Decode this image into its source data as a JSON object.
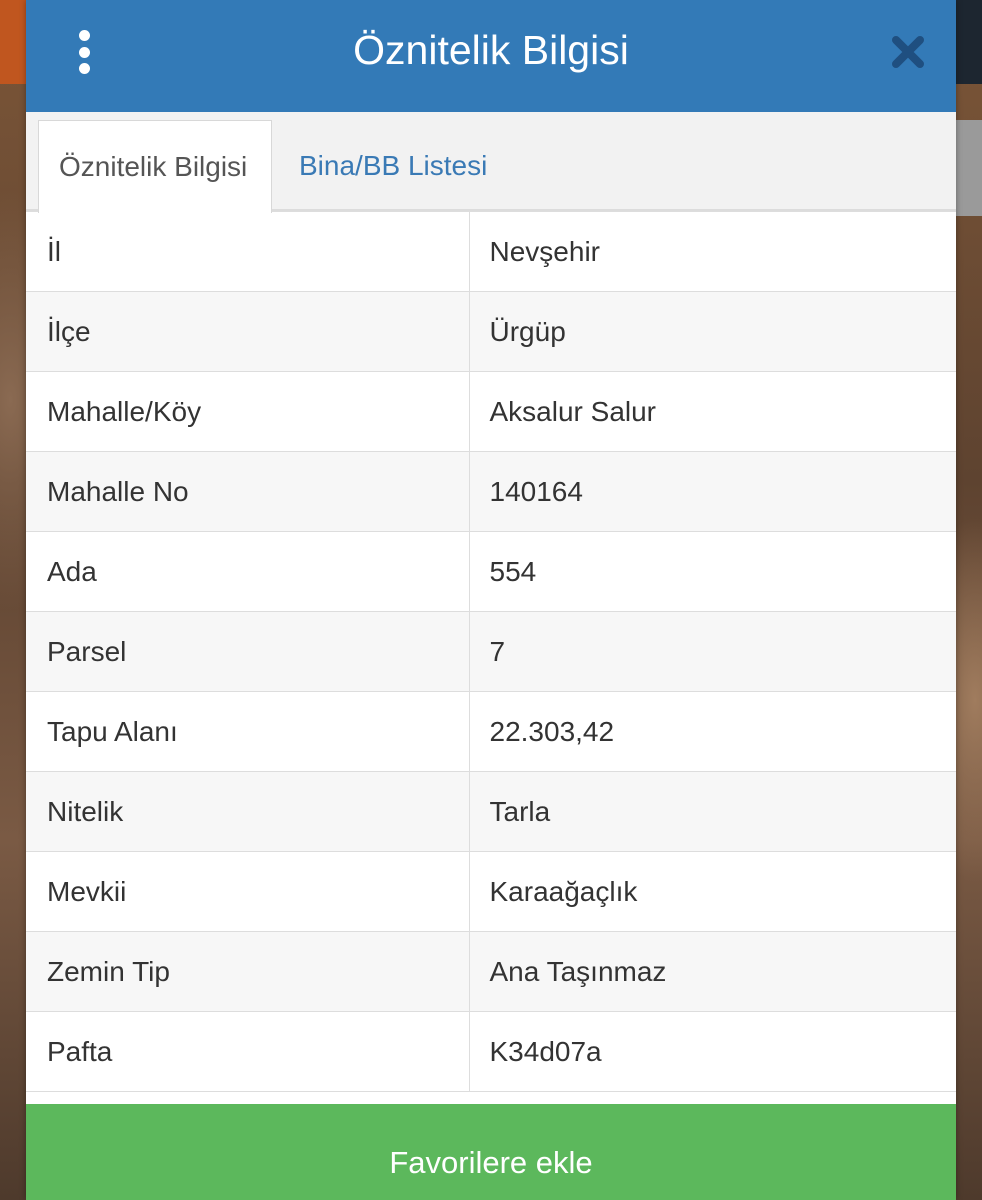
{
  "dialog": {
    "title": "Öznitelik Bilgisi",
    "menu_icon": "kebab-menu-icon",
    "close_icon": "close-icon"
  },
  "tabs": [
    {
      "label": "Öznitelik Bilgisi",
      "active": true
    },
    {
      "label": "Bina/BB Listesi",
      "active": false
    }
  ],
  "attributes": [
    {
      "key": "İl",
      "value": "Nevşehir"
    },
    {
      "key": "İlçe",
      "value": "Ürgüp"
    },
    {
      "key": "Mahalle/Köy",
      "value": "Aksalur Salur"
    },
    {
      "key": "Mahalle No",
      "value": "140164"
    },
    {
      "key": "Ada",
      "value": "554"
    },
    {
      "key": "Parsel",
      "value": "7"
    },
    {
      "key": "Tapu Alanı",
      "value": "22.303,42"
    },
    {
      "key": "Nitelik",
      "value": "Tarla"
    },
    {
      "key": "Mevkii",
      "value": "Karaağaçlık"
    },
    {
      "key": "Zemin Tip",
      "value": "Ana Taşınmaz"
    },
    {
      "key": "Pafta",
      "value": "K34d07a"
    }
  ],
  "footer": {
    "favorite_label": "Favorilere ekle"
  },
  "colors": {
    "header": "#337ab7",
    "tab_link": "#3a7ab5",
    "favorite_button": "#5cb85c"
  }
}
